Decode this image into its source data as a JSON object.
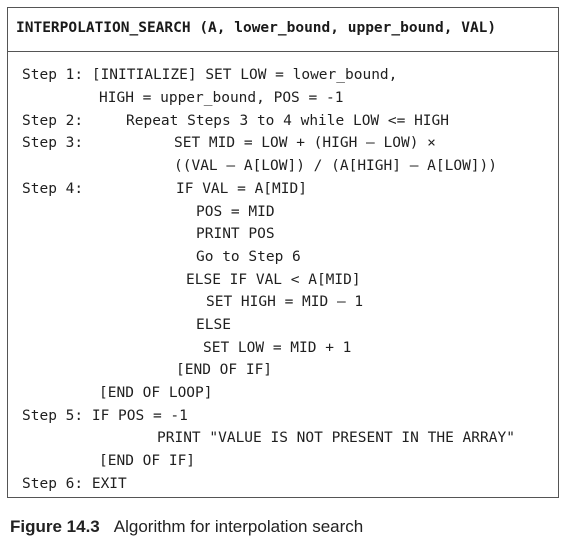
{
  "algorithm": {
    "title": "INTERPOLATION_SEARCH (A, lower_bound, upper_bound, VAL)",
    "lines": [
      "Step 1: [INITIALIZE] SET LOW = lower_bound,",
      "HIGH = upper_bound, POS = -1",
      "Step 2:",
      "Repeat Steps 3 to 4 while LOW <= HIGH",
      "Step 3:",
      "SET MID = LOW + (HIGH – LOW) ×",
      "((VAL – A[LOW]) / (A[HIGH] – A[LOW]))",
      "Step 4:",
      "IF VAL = A[MID]",
      "POS = MID",
      "PRINT POS",
      "Go to Step 6",
      "ELSE IF VAL < A[MID]",
      "SET HIGH = MID – 1",
      "ELSE",
      "SET LOW = MID + 1",
      "[END OF IF]",
      "[END OF LOOP]",
      "Step 5: IF POS = -1",
      "PRINT \"VALUE IS NOT PRESENT IN THE ARRAY\"",
      "[END OF IF]",
      "Step 6: EXIT"
    ]
  },
  "caption": {
    "label": "Figure 14.3",
    "text": "Algorithm for interpolation search"
  }
}
